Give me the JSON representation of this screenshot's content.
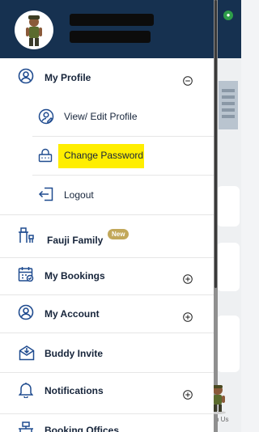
{
  "menu": {
    "my_profile": "My Profile",
    "view_edit_profile": "View/ Edit Profile",
    "change_password": "Change Password",
    "logout": "Logout",
    "fauji_family": "Fauji Family",
    "new_badge": "New",
    "my_bookings": "My Bookings",
    "my_account": "My Account",
    "buddy_invite": "Buddy Invite",
    "notifications": "Notifications",
    "booking_offices": "Booking Offices"
  },
  "background": {
    "partial_text": "n Us"
  },
  "colors": {
    "header": "#163150",
    "text": "#16243a",
    "icon": "#1f4b8f",
    "highlight": "#ffee00",
    "badge": "#c2a85a"
  },
  "icons": {
    "my_profile": "user-circle-icon",
    "view_edit_profile": "user-edit-icon",
    "change_password": "lock-icon",
    "logout": "logout-icon",
    "fauji_family": "desk-chair-icon",
    "my_bookings": "calendar-check-icon",
    "my_account": "user-circle-icon",
    "buddy_invite": "envelope-download-icon",
    "notifications": "bell-icon",
    "booking_offices": "office-icon",
    "expand": "plus-circle-icon",
    "collapse": "minus-circle-icon"
  }
}
